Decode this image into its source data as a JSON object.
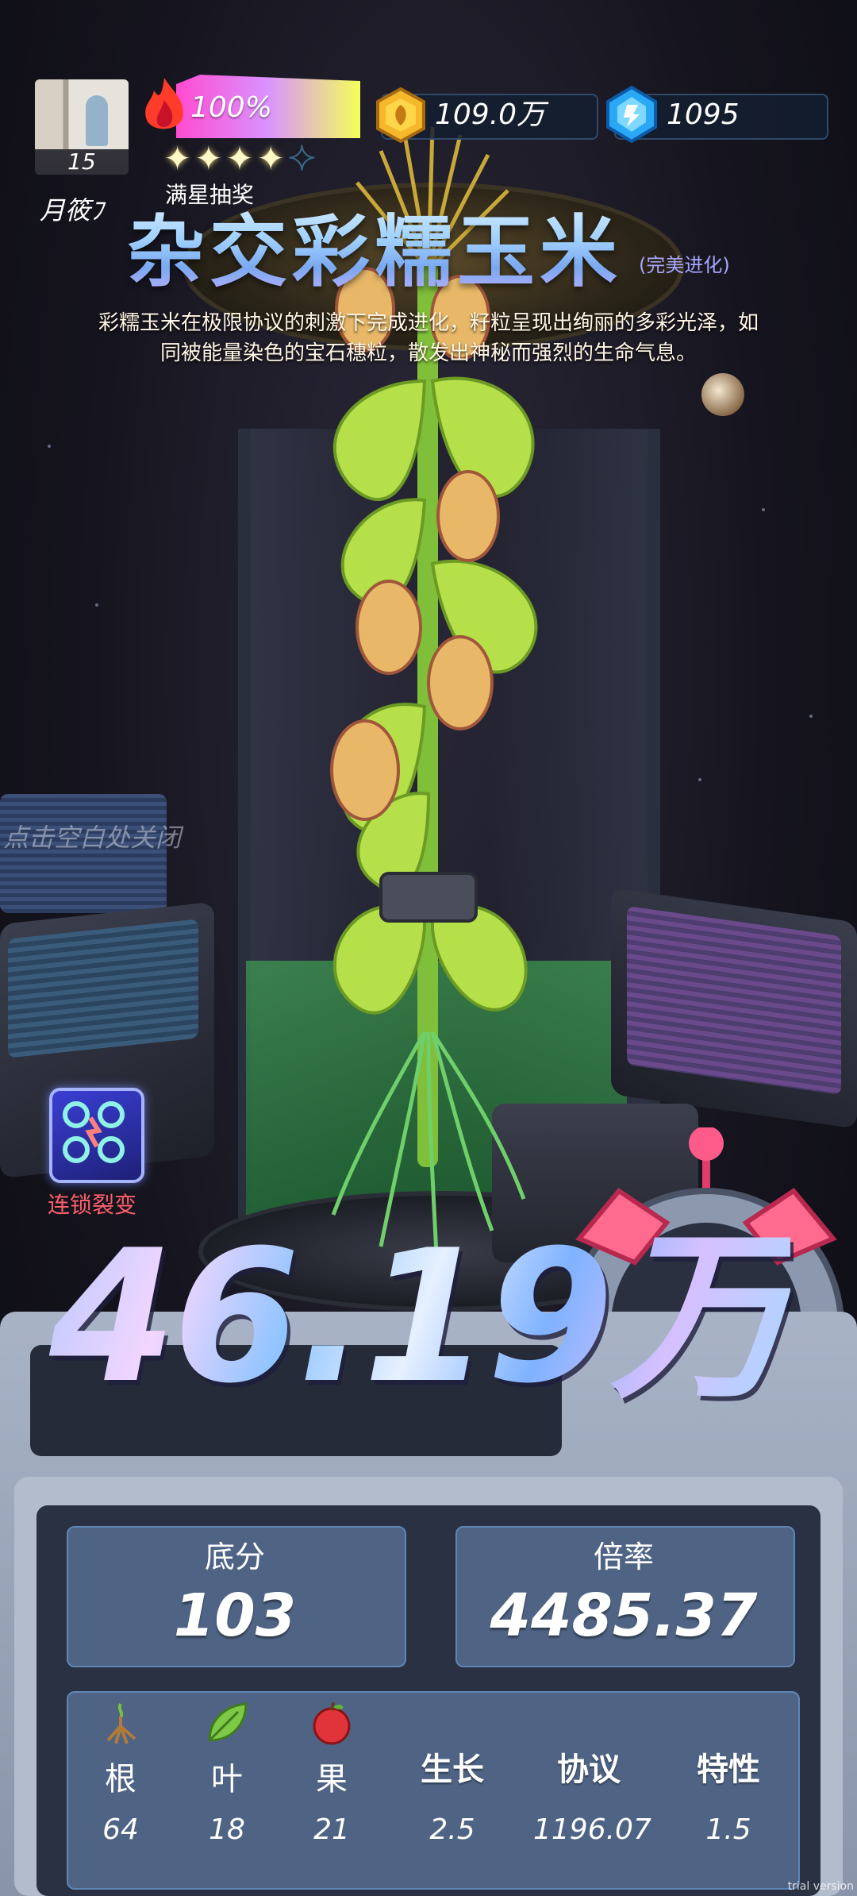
{
  "player": {
    "level": "15",
    "name": "月筱ﾌ"
  },
  "heat": {
    "percent": "100%",
    "stars_filled": 4,
    "stars_total": 5
  },
  "lottery_label": "满星抽奖",
  "resources": {
    "coins": "109.0万",
    "gems": "1095"
  },
  "plant": {
    "title": "杂交彩糯玉米",
    "tag": "(完美进化)",
    "description_lines": [
      "彩糯玉米在极限协议的刺激下完成进化，籽粒呈现出绚丽的多彩光泽，如",
      "同被能量染色的宝石穗粒，散发出神秘而强烈的生命气息。"
    ]
  },
  "close_hint": "点击空白处关闭",
  "skill": {
    "label": "连锁裂变",
    "icon": "chain-fission-icon"
  },
  "total_score": "46.19万",
  "stats": {
    "base_label": "底分",
    "base_value": "103",
    "mult_label": "倍率",
    "mult_value": "4485.37"
  },
  "attributes": [
    {
      "name": "根",
      "icon": "root-icon",
      "value": "64"
    },
    {
      "name": "叶",
      "icon": "leaf-icon",
      "value": "18"
    },
    {
      "name": "果",
      "icon": "apple-icon",
      "value": "21"
    },
    {
      "name": "生长",
      "value": "2.5"
    },
    {
      "name": "协议",
      "value": "1196.07"
    },
    {
      "name": "特性",
      "value": "1.5"
    }
  ],
  "watermark": "trial version",
  "colors": {
    "panel": "#4f6485",
    "panel_border": "#5d86b6",
    "skill_label": "#ff5e6c",
    "title_gradient_top": "#e4f6ff",
    "title_gradient_bottom": "#7aa8f0"
  }
}
